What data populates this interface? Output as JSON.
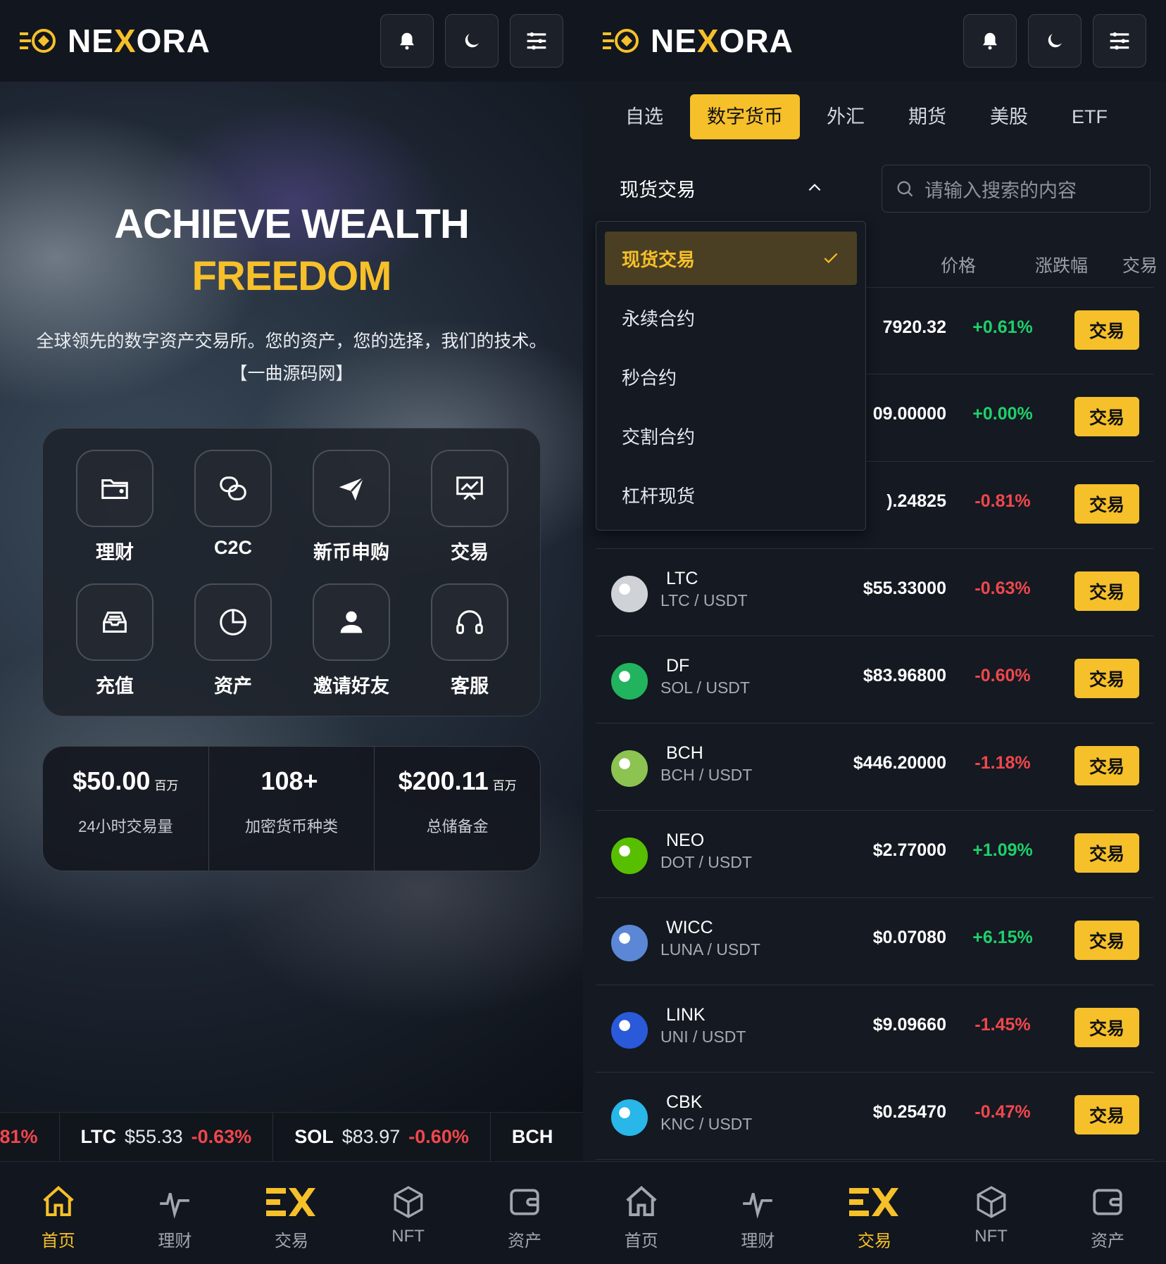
{
  "brand": {
    "name_pre": "NE",
    "name_x": "X",
    "name_post": "ORA",
    "accent": "#f6c02a"
  },
  "header": {
    "buttons": [
      "bell-icon",
      "moon-icon",
      "menu-icon"
    ]
  },
  "home": {
    "hero_title_1": "ACHIEVE WEALTH",
    "hero_title_2": "FREEDOM",
    "hero_subtitle": "全球领先的数字资产交易所。您的资产，您的选择，我们的技术。【一曲源码网】",
    "quick_actions": [
      {
        "label": "理财",
        "icon": "folder-icon"
      },
      {
        "label": "C2C",
        "icon": "link-icon"
      },
      {
        "label": "新币申购",
        "icon": "send-icon"
      },
      {
        "label": "交易",
        "icon": "presentation-chart-icon"
      },
      {
        "label": "充值",
        "icon": "inbox-icon"
      },
      {
        "label": "资产",
        "icon": "pie-chart-icon"
      },
      {
        "label": "邀请好友",
        "icon": "user-icon"
      },
      {
        "label": "客服",
        "icon": "headphones-icon"
      }
    ],
    "stats": [
      {
        "value": "$50.00",
        "unit": "百万",
        "label": "24小时交易量"
      },
      {
        "value": "108+",
        "unit": "",
        "label": "加密货币种类"
      },
      {
        "value": "$200.11",
        "unit": "百万",
        "label": "总储备金"
      }
    ],
    "ticker": [
      {
        "symbol": "",
        "price": "",
        "change": ".81%"
      },
      {
        "symbol": "LTC",
        "price": "$55.33",
        "change": "-0.63%"
      },
      {
        "symbol": "SOL",
        "price": "$83.97",
        "change": "-0.60%"
      },
      {
        "symbol": "BCH",
        "price": "",
        "change": ""
      }
    ]
  },
  "nav": {
    "items": [
      {
        "label": "首页",
        "icon": "home-icon"
      },
      {
        "label": "理财",
        "icon": "pulse-icon"
      },
      {
        "label": "交易",
        "icon": "exchange-logo-icon"
      },
      {
        "label": "NFT",
        "icon": "cube-icon"
      },
      {
        "label": "资产",
        "icon": "wallet-icon"
      }
    ]
  },
  "market": {
    "tabs": [
      "自选",
      "数字货币",
      "外汇",
      "期货",
      "美股",
      "ETF"
    ],
    "active_tab": "数字货币",
    "select_value": "现货交易",
    "search_placeholder": "请输入搜索的内容",
    "columns": {
      "price": "价格",
      "change": "涨跌幅",
      "trade": "交易"
    },
    "dropdown_options": [
      "现货交易",
      "永续合约",
      "秒合约",
      "交割合约",
      "杠杆现货"
    ],
    "trade_label": "交易",
    "rows": [
      {
        "name": "",
        "pair": "",
        "price": "7920.32",
        "change": "+0.61%",
        "dir": "up",
        "icon_color": ""
      },
      {
        "name": "",
        "pair": "",
        "price": "09.00000",
        "change": "+0.00%",
        "dir": "up",
        "icon_color": ""
      },
      {
        "name": "",
        "pair": "",
        "price": ").24825",
        "change": "-0.81%",
        "dir": "down",
        "icon_color": ""
      },
      {
        "name": "LTC",
        "pair": "LTC / USDT",
        "price": "$55.33000",
        "change": "-0.63%",
        "dir": "down",
        "icon_color": "#cfd3d8"
      },
      {
        "name": "DF",
        "pair": "SOL / USDT",
        "price": "$83.96800",
        "change": "-0.60%",
        "dir": "down",
        "icon_color": "#22b35e"
      },
      {
        "name": "BCH",
        "pair": "BCH / USDT",
        "price": "$446.20000",
        "change": "-1.18%",
        "dir": "down",
        "icon_color": "#8dc351"
      },
      {
        "name": "NEO",
        "pair": "DOT / USDT",
        "price": "$2.77000",
        "change": "+1.09%",
        "dir": "up",
        "icon_color": "#58bf00"
      },
      {
        "name": "WICC",
        "pair": "LUNA / USDT",
        "price": "$0.07080",
        "change": "+6.15%",
        "dir": "up",
        "icon_color": "#5b87d6"
      },
      {
        "name": "LINK",
        "pair": "UNI / USDT",
        "price": "$9.09660",
        "change": "-1.45%",
        "dir": "down",
        "icon_color": "#2a5ada"
      },
      {
        "name": "CBK",
        "pair": "KNC / USDT",
        "price": "$0.25470",
        "change": "-0.47%",
        "dir": "down",
        "icon_color": "#29b6e8"
      }
    ]
  }
}
